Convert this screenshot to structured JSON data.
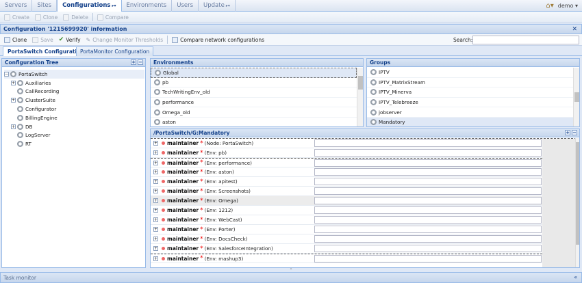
{
  "topnav": {
    "tabs": [
      "Servers",
      "Sites",
      "Configurations",
      "Environments",
      "Users",
      "Update"
    ],
    "active_index": 2,
    "user": "demo"
  },
  "toolbar1": {
    "create": "Create",
    "clone": "Clone",
    "delete": "Delete",
    "compare": "Compare"
  },
  "info_panel": {
    "title": "Configuration '1215699920' information"
  },
  "toolbar2": {
    "clone": "Clone",
    "save": "Save",
    "verify": "Verify",
    "change_thresholds": "Change Monitor Thresholds",
    "compare_network": "Compare network configurations",
    "search_label": "Search:",
    "search_value": ""
  },
  "subtabs": [
    "PortaSwitch Configuration",
    "PortaMonitor Configuration"
  ],
  "config_tree": {
    "title": "Configuration Tree",
    "root": "PortaSwitch",
    "items": [
      "Auxiliaries",
      "CallRecording",
      "ClusterSuite",
      "Configurator",
      "BillingEngine",
      "DB",
      "LogServer",
      "RT"
    ]
  },
  "environments": {
    "title": "Environments",
    "items": [
      "Global",
      "pb",
      "TechWritingEnv_old",
      "performance",
      "Omega_old",
      "aston"
    ]
  },
  "groups": {
    "title": "Groups",
    "items": [
      "IPTV",
      "IPTV_MatrixStream",
      "IPTV_Minerva",
      "IPTV_Telebreeze",
      "jobserver",
      "Mandatory"
    ]
  },
  "mandatory": {
    "title": "/PortaSwitch/G:Mandatory",
    "param": "maintainer",
    "rows": [
      "(Node: PortaSwitch)",
      "(Env: pb)",
      "(Env: performance)",
      "(Env: aston)",
      "(Env: apitest)",
      "(Env: Screenshots)",
      "(Env: Omega)",
      "(Env: 1212)",
      "(Env: WebCast)",
      "(Env: Porter)",
      "(Env: DocsCheck)",
      "(Env: SalesforceIntegration)",
      "(Env: mashup3)"
    ]
  },
  "task_monitor": {
    "title": "Task monitor"
  }
}
